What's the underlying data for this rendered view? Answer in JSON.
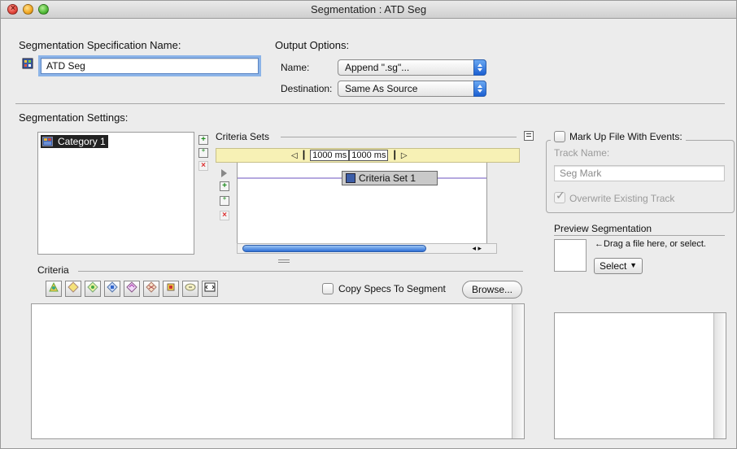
{
  "window": {
    "title": "Segmentation : ATD Seg"
  },
  "spec": {
    "heading": "Segmentation Specification Name:",
    "name_value": "ATD Seg"
  },
  "output": {
    "heading": "Output Options:",
    "name_label": "Name:",
    "name_value": "Append \".sg\"...",
    "destination_label": "Destination:",
    "destination_value": "Same As Source"
  },
  "settings": {
    "heading": "Segmentation Settings:",
    "categories": [
      "Category 1"
    ],
    "criteria_sets_label": "Criteria Sets",
    "timeline_left": "1000 ms",
    "timeline_right": "1000 ms",
    "criteria_set_item": "Criteria Set 1"
  },
  "criteria": {
    "heading": "Criteria",
    "copy_specs_label": "Copy Specs To Segment",
    "browse_label": "Browse...",
    "tool_icons": [
      "criteria-tool-1-icon",
      "criteria-tool-2-icon",
      "criteria-tool-3-icon",
      "criteria-tool-4-icon",
      "criteria-tool-5-icon",
      "criteria-tool-6-icon",
      "criteria-tool-7-icon",
      "criteria-tool-8-icon",
      "criteria-tool-9-icon"
    ]
  },
  "markup": {
    "checkbox_label": "Mark Up File With Events:",
    "track_name_label": "Track Name:",
    "track_name_value": "Seg Mark",
    "overwrite_label": "Overwrite Existing Track"
  },
  "preview": {
    "heading": "Preview Segmentation",
    "drag_hint": "Drag a file here, or select.",
    "select_label": "Select"
  }
}
